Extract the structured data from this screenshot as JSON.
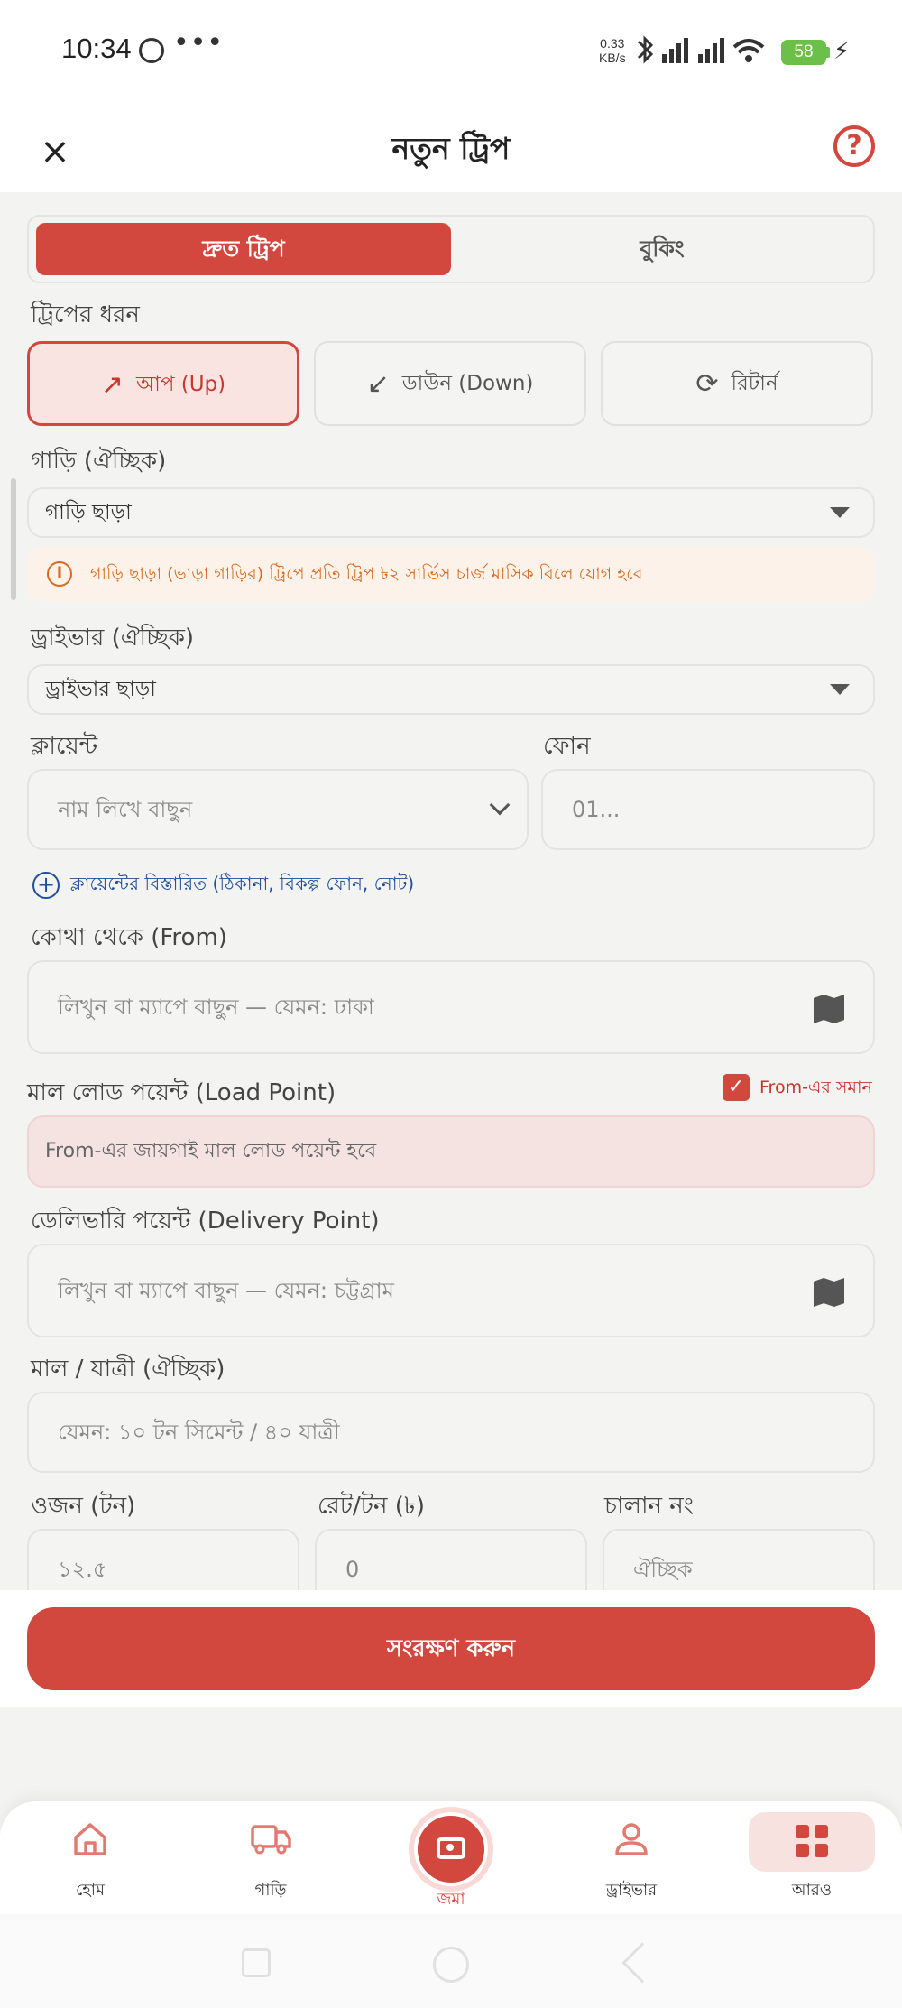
{
  "status_bar": {
    "time": "10:34",
    "dots": "•••",
    "speed_value": "0.33",
    "speed_unit": "KB/s",
    "battery": "58"
  },
  "header": {
    "title": "নতুন ট্রিপ",
    "close_icon": "×",
    "help_icon": "?"
  },
  "mode_tabs": {
    "quick": "দ্রুত ট্রিপ",
    "booking": "বুকিং"
  },
  "trip_type": {
    "label": "ট্রিপের ধরন",
    "up": "আপ (Up)",
    "down": "ডাউন (Down)",
    "return": "রিটার্ন"
  },
  "vehicle": {
    "label": "গাড়ি (ঐচ্ছিক)",
    "value": "গাড়ি ছাড়া",
    "notice": "গাড়ি ছাড়া (ভাড়া গাড়ির) ট্রিপে প্রতি ট্রিপ ৳২ সার্ভিস চার্জ মাসিক বিলে যোগ হবে"
  },
  "driver": {
    "label": "ড্রাইভার (ঐচ্ছিক)",
    "value": "ড্রাইভার ছাড়া"
  },
  "client": {
    "label": "ক্লায়েন্ট",
    "placeholder": "নাম লিখে বাছুন",
    "phone_label": "ফোন",
    "phone_placeholder": "01...",
    "details_link": "ক্লায়েন্টের বিস্তারিত (ঠিকানা, বিকল্প ফোন, নোট)"
  },
  "from": {
    "label": "কোথা থেকে (From)",
    "placeholder": "লিখুন বা ম্যাপে বাছুন — যেমন: ঢাকা"
  },
  "load_point": {
    "label": "মাল লোড পয়েন্ট (Load Point)",
    "checkbox_label": "From-এর সমান",
    "info": "From-এর জায়গাই মাল লোড পয়েন্ট হবে"
  },
  "delivery": {
    "label": "ডেলিভারি পয়েন্ট (Delivery Point)",
    "placeholder": "লিখুন বা ম্যাপে বাছুন — যেমন: চট্টগ্রাম"
  },
  "goods": {
    "label": "মাল / যাত্রী (ঐচ্ছিক)",
    "placeholder": "যেমন: ১০ টন সিমেন্ট / ৪০ যাত্রী"
  },
  "weight": {
    "label": "ওজন (টন)",
    "placeholder": "১২.৫"
  },
  "rate": {
    "label": "রেট/টন (৳)",
    "placeholder": "0"
  },
  "challan": {
    "label": "চালান নং",
    "placeholder": "ঐচ্ছিক"
  },
  "save_button": "সংরক্ষণ করুন",
  "nav": {
    "home": "হোম",
    "vehicle": "গাড়ি",
    "deposit": "জমা",
    "driver": "ড্রাইভার",
    "more": "আরও"
  },
  "colors": {
    "accent": "#d2473e",
    "notice": "#d86b1f",
    "link": "#1f4e9c"
  }
}
